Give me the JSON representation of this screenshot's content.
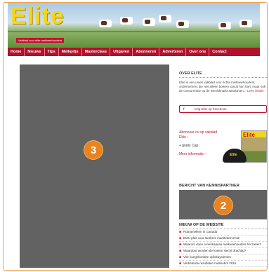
{
  "header": {
    "logo_text": "Elite",
    "tagline": "Vakblad voor elite melkveehouders"
  },
  "nav": {
    "items": [
      "Home",
      "Nieuws",
      "Tips",
      "Melkprijs",
      "Masterclass",
      "Uitgaven",
      "Abonneren",
      "Adverteren",
      "Over ons",
      "Contact"
    ]
  },
  "main": {
    "placeholder_badge": "3"
  },
  "sidebar": {
    "about_heading": "OVER ELITE",
    "about_text": "Elite is een uniek vakblad voor échte melkveehouders; ondernemers die niet alleen boeren vanuit hun hart, maar ook de concurrentie op de wereldmarkt aandurven...",
    "about_more": "Lees verder ›",
    "facebook_icon": "f",
    "facebook_label": "Volg Elite op Facebook ›",
    "promo_title": "Abonneer nu op vakblad Elite ›",
    "promo_gift": "+ gratis Cap",
    "promo_more": "Meer informatie ›",
    "magazine_title": "Elite",
    "cap_text": "Elite",
    "partner_heading": "BERICHT VAN KENNISPARTNER",
    "partner_badge": "2",
    "news_heading": "NIEUW OP DE WEBSITE",
    "news_items": [
      "Robotmelken in Canada",
      "EMU pleit voor sterkere marktinterventie",
      "Waarom doen Amerikaanse melkveehouders het beter?",
      "Waardoor worden de koeien slecht drachtig?",
      "Vier koegebonden opfokaysiemen",
      "Verbeterde resultaten melkrobot 2015"
    ]
  },
  "colors": {
    "brand_red": "#b0122a",
    "logo_yellow": "#f4d51c",
    "badge_orange": "#e8831f",
    "placeholder_gray": "#626262"
  }
}
